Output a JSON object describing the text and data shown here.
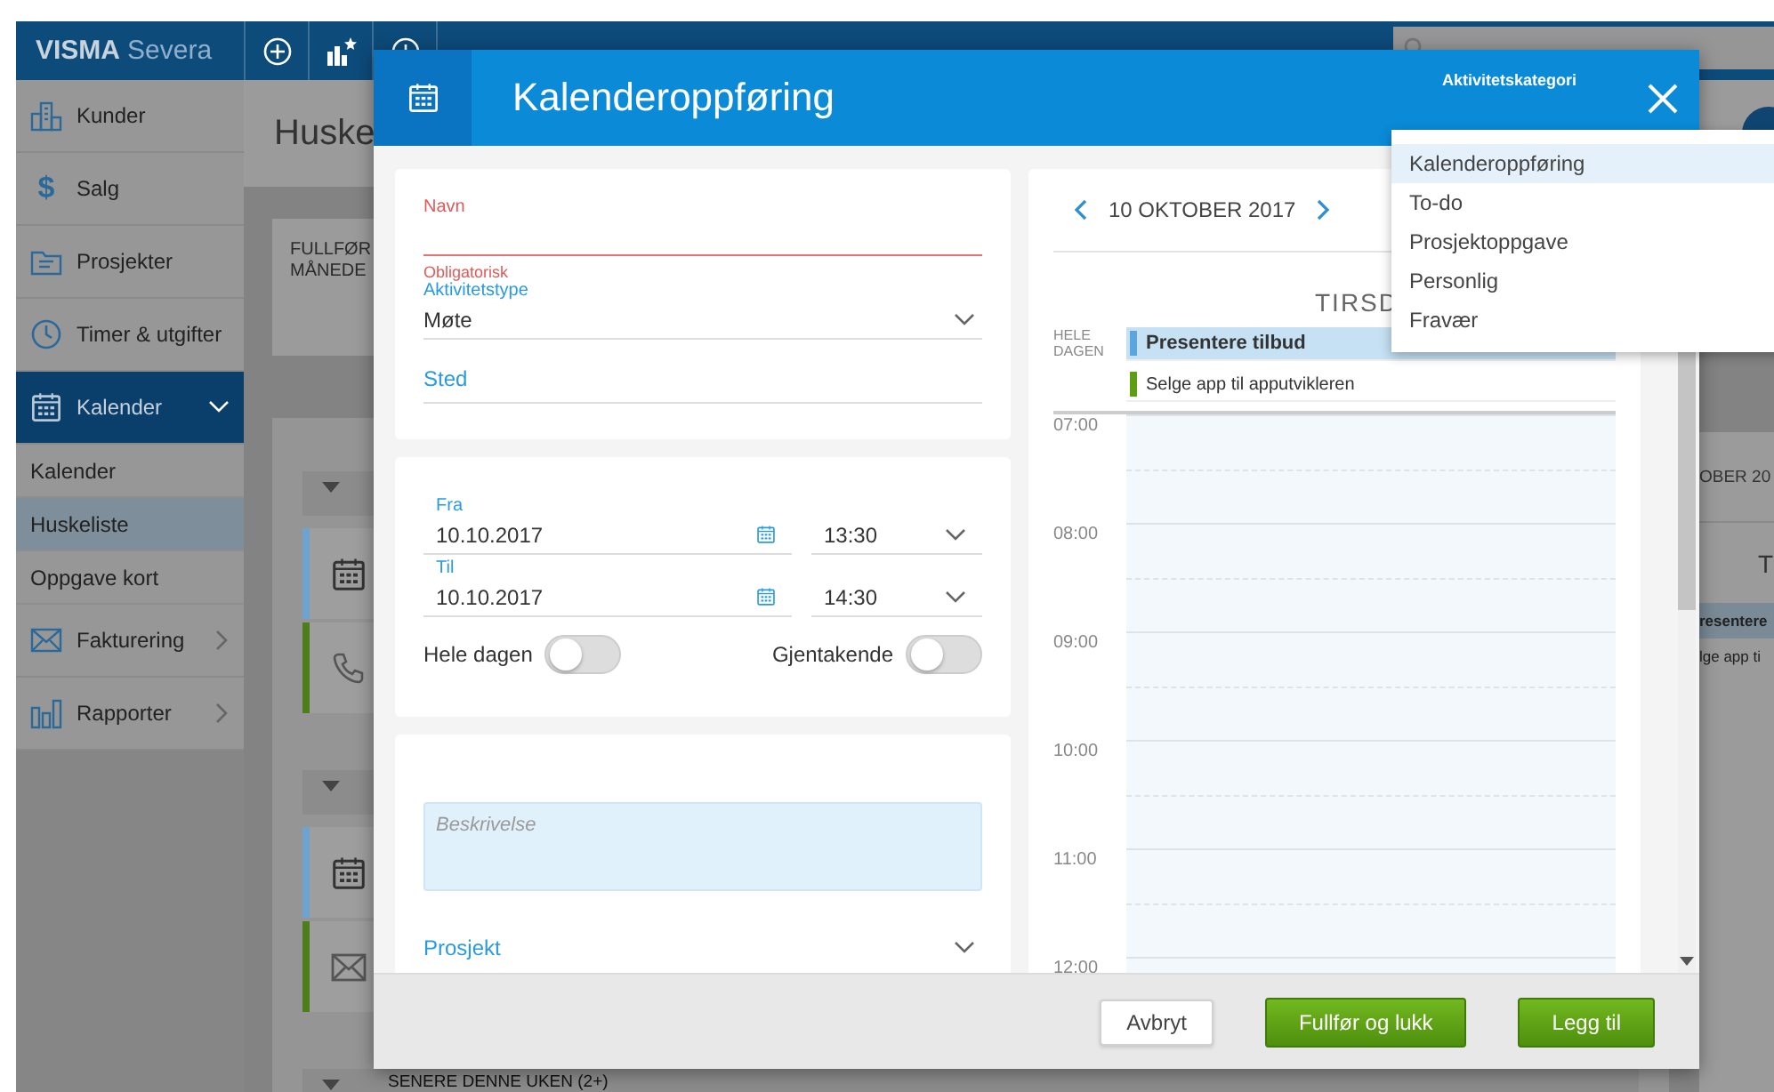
{
  "topbar": {
    "brand": "VISMA",
    "product": "Severa"
  },
  "sidebar": {
    "items": [
      {
        "label": "Kunder",
        "selected": false
      },
      {
        "label": "Salg",
        "glyph": "$",
        "selected": false
      },
      {
        "label": "Prosjekter",
        "selected": false
      },
      {
        "label": "Timer & utgifter",
        "selected": false
      },
      {
        "label": "Kalender",
        "selected": true,
        "expanded": true,
        "children": [
          {
            "label": "Kalender",
            "selected": false
          },
          {
            "label": "Huskeliste",
            "selected": true
          },
          {
            "label": "Oppgave kort",
            "selected": false
          }
        ]
      },
      {
        "label": "Fakturering",
        "selected": false,
        "expanded": false
      },
      {
        "label": "Rapporter",
        "selected": false,
        "expanded": false
      }
    ]
  },
  "page": {
    "title": "Huske",
    "summary": [
      "FULLFØR",
      "MÅNEDE"
    ],
    "groups": [
      {
        "rows": [
          {
            "kind": "meeting",
            "color": "#6fa3cf"
          },
          {
            "kind": "call",
            "color": "#4e7d1c"
          }
        ]
      },
      {
        "rows": [
          {
            "kind": "meeting",
            "color": "#6fa3cf"
          },
          {
            "kind": "email",
            "color": "#4e7d1c"
          }
        ]
      },
      {
        "title": "SENERE DENNE UKEN (2+)"
      }
    ]
  },
  "side_calendar": {
    "date": "OBER 20",
    "day": "T",
    "events": [
      {
        "title": "resentere",
        "highlighted": true
      },
      {
        "title": "lge app ti",
        "highlighted": false
      }
    ]
  },
  "dialog": {
    "title": "Kalenderoppføring",
    "category_label": "Aktivitetskategori",
    "form": {
      "name": {
        "label": "Navn",
        "error": "Obligatorisk"
      },
      "activity_type": {
        "label": "Aktivitetstype",
        "value": "Møte"
      },
      "location": {
        "label": "Sted"
      },
      "from": {
        "label": "Fra",
        "date": "10.10.2017",
        "time": "13:30"
      },
      "to": {
        "label": "Til",
        "date": "10.10.2017",
        "time": "14:30"
      },
      "all_day": {
        "label": "Hele dagen",
        "on": false
      },
      "recurring": {
        "label": "Gjentakende",
        "on": false
      },
      "description": {
        "placeholder": "Beskrivelse"
      },
      "project": {
        "label": "Prosjekt"
      }
    },
    "calendar": {
      "date": "10 OKTOBER 2017",
      "day": "TIRSD",
      "all_day_label": "HELE DAGEN",
      "events": [
        {
          "title": "Presentere tilbud",
          "color": "#5aa6dd",
          "highlighted": true
        },
        {
          "title": "Selge app til apputvikleren",
          "color": "#5e9e10",
          "highlighted": false
        }
      ],
      "hours": [
        "07:00",
        "08:00",
        "09:00",
        "10:00",
        "11:00",
        "12:00"
      ]
    },
    "buttons": [
      {
        "label": "Avbryt",
        "kind": "secondary"
      },
      {
        "label": "Fullfør og lukk",
        "kind": "primary"
      },
      {
        "label": "Legg til",
        "kind": "primary"
      }
    ]
  },
  "category_menu": {
    "items": [
      {
        "label": "Kalenderoppføring",
        "selected": true
      },
      {
        "label": "To-do",
        "selected": false
      },
      {
        "label": "Prosjektoppgave",
        "selected": false
      },
      {
        "label": "Personlig",
        "selected": false
      },
      {
        "label": "Fravær",
        "selected": false
      }
    ]
  }
}
